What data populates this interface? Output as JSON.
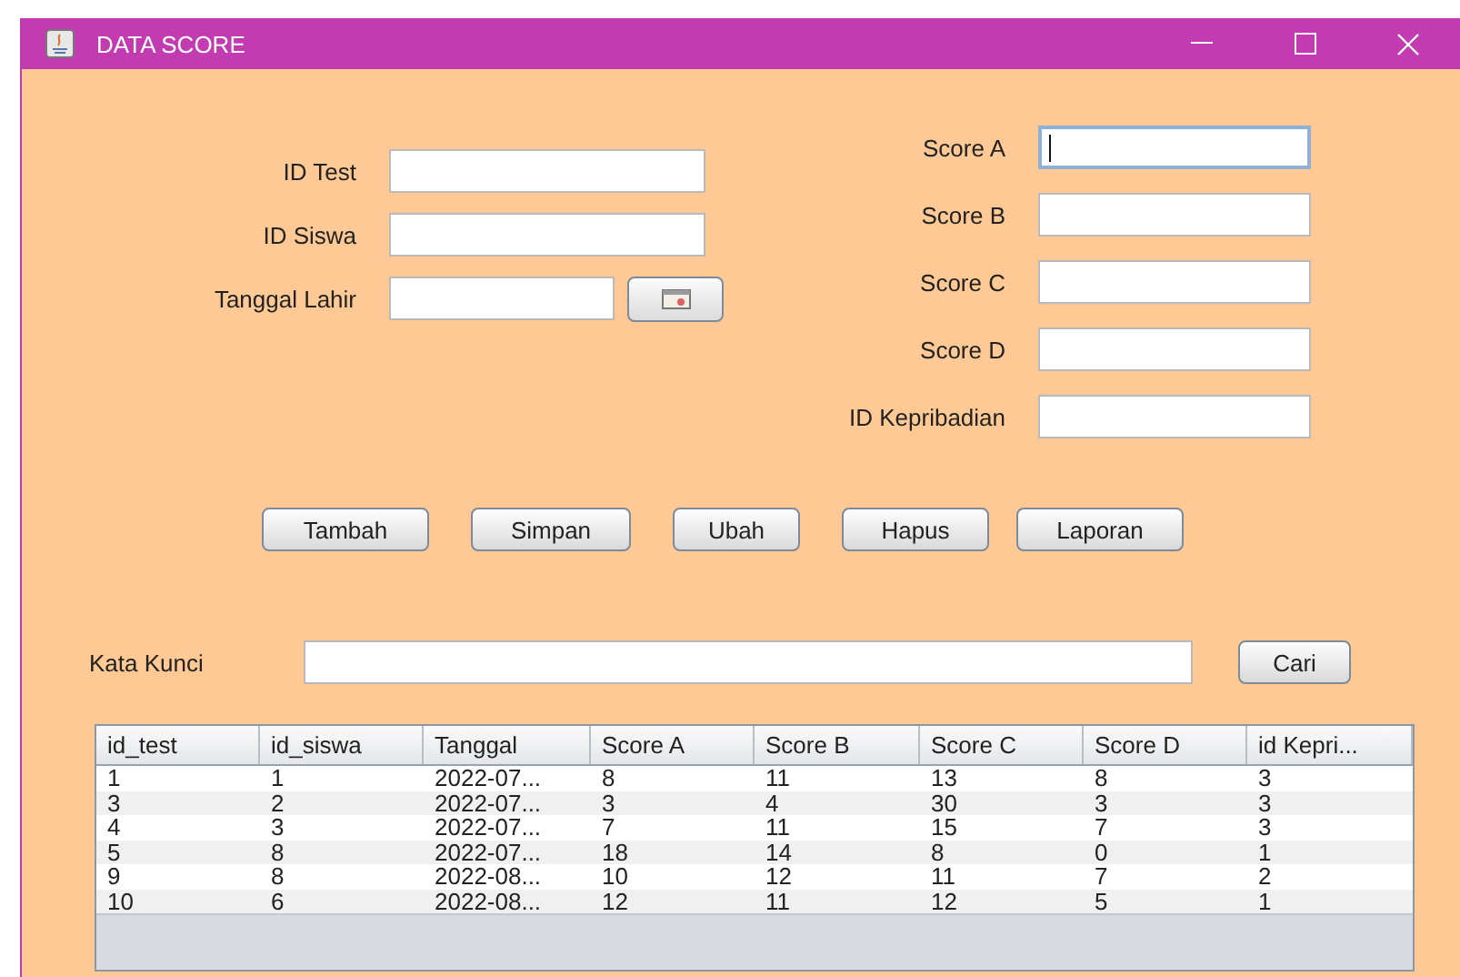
{
  "window": {
    "title": "DATA SCORE"
  },
  "left_fields": [
    {
      "label": "ID Test",
      "focused": false,
      "kind": "text"
    },
    {
      "label": "ID Siswa",
      "focused": false,
      "kind": "text"
    },
    {
      "label": "Tanggal Lahir",
      "focused": false,
      "kind": "date"
    }
  ],
  "right_fields": [
    {
      "label": "Score A",
      "focused": true,
      "kind": "text"
    },
    {
      "label": "Score B",
      "focused": false,
      "kind": "text"
    },
    {
      "label": "Score C",
      "focused": false,
      "kind": "text"
    },
    {
      "label": "Score D",
      "focused": false,
      "kind": "text"
    },
    {
      "label": "ID Kepribadian",
      "focused": false,
      "kind": "text"
    }
  ],
  "buttons": [
    "Tambah",
    "Simpan",
    "Ubah",
    "Hapus",
    "Laporan"
  ],
  "search": {
    "label": "Kata Kunci",
    "button": "Cari"
  },
  "table": {
    "columns": [
      "id_test",
      "id_siswa",
      "Tanggal",
      "Score A",
      "Score B",
      "Score C",
      "Score D",
      "id Kepri..."
    ],
    "rows": [
      [
        "1",
        "1",
        "2022-07...",
        "8",
        "11",
        "13",
        "8",
        "3"
      ],
      [
        "3",
        "2",
        "2022-07...",
        "3",
        "4",
        "30",
        "3",
        "3"
      ],
      [
        "4",
        "3",
        "2022-07...",
        "7",
        "11",
        "15",
        "7",
        "3"
      ],
      [
        "5",
        "8",
        "2022-07...",
        "18",
        "14",
        "8",
        "0",
        "1"
      ],
      [
        "9",
        "8",
        "2022-08...",
        "10",
        "12",
        "11",
        "7",
        "2"
      ],
      [
        "10",
        "6",
        "2022-08...",
        "12",
        "11",
        "12",
        "5",
        "1"
      ]
    ]
  }
}
